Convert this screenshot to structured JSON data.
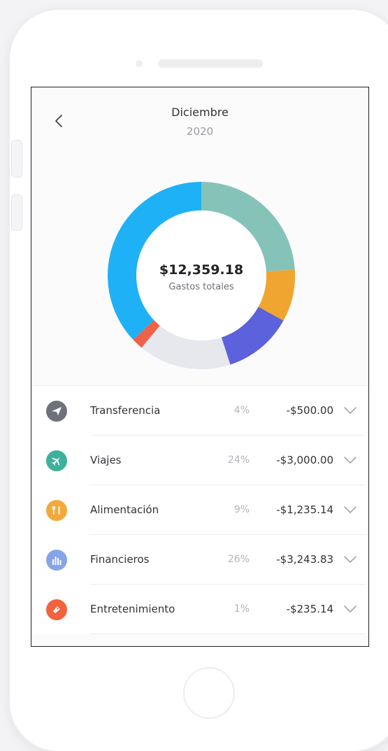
{
  "header": {
    "month": "Diciembre",
    "year": "2020"
  },
  "summary": {
    "total": "$12,359.18",
    "label": "Gastos totales"
  },
  "chart_data": {
    "type": "pie",
    "segments": [
      {
        "color": "#85c3b9",
        "value": 24
      },
      {
        "color": "#f0a530",
        "value": 9
      },
      {
        "color": "#5b62dc",
        "value": 12
      },
      {
        "color": "#e6e8ee",
        "value": 16
      },
      {
        "color": "#f0614b",
        "value": 2
      },
      {
        "color": "#1fb1f5",
        "value": 37
      }
    ]
  },
  "categories": [
    {
      "name": "Transferencia",
      "percent": "4%",
      "amount": "-$500.00",
      "icon": "paper-plane-icon",
      "color": "#6e7179"
    },
    {
      "name": "Viajes",
      "percent": "24%",
      "amount": "-$3,000.00",
      "icon": "airplane-icon",
      "color": "#3fb09d"
    },
    {
      "name": "Alimentación",
      "percent": "9%",
      "amount": "-$1,235.14",
      "icon": "cutlery-icon",
      "color": "#f3a93a"
    },
    {
      "name": "Financieros",
      "percent": "26%",
      "amount": "-$3,243.83",
      "icon": "bar-chart-icon",
      "color": "#86a4e8"
    },
    {
      "name": "Entretenimiento",
      "percent": "1%",
      "amount": "-$235.14",
      "icon": "ticket-icon",
      "color": "#f0633d"
    }
  ]
}
